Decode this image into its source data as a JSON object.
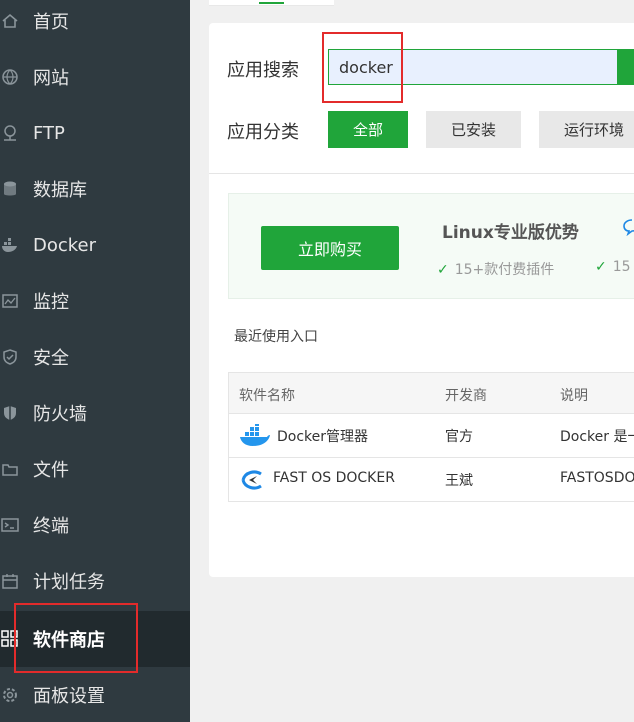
{
  "sidebar": {
    "items": [
      {
        "label": "首页",
        "icon": "home-icon"
      },
      {
        "label": "网站",
        "icon": "globe-icon"
      },
      {
        "label": "FTP",
        "icon": "ftp-icon"
      },
      {
        "label": "数据库",
        "icon": "database-icon"
      },
      {
        "label": "Docker",
        "icon": "docker-icon"
      },
      {
        "label": "监控",
        "icon": "monitor-icon"
      },
      {
        "label": "安全",
        "icon": "shield-icon"
      },
      {
        "label": "防火墙",
        "icon": "firewall-icon"
      },
      {
        "label": "文件",
        "icon": "folder-icon"
      },
      {
        "label": "终端",
        "icon": "terminal-icon"
      },
      {
        "label": "计划任务",
        "icon": "calendar-icon"
      },
      {
        "label": "软件商店",
        "icon": "grid-icon",
        "active": true
      },
      {
        "label": "面板设置",
        "icon": "gear-icon"
      }
    ]
  },
  "search": {
    "label": "应用搜索",
    "value": "docker"
  },
  "category": {
    "label": "应用分类",
    "all": "全部",
    "installed": "已安装",
    "runtime": "运行环境"
  },
  "promo": {
    "buy_label": "立即购买",
    "title": "Linux专业版优势",
    "features": [
      "15+款付费插件",
      "15"
    ]
  },
  "recent_label": "最近使用入口",
  "table": {
    "headers": [
      "软件名称",
      "开发商",
      "说明"
    ],
    "rows": [
      {
        "name": "Docker管理器",
        "dev": "官方",
        "desc": "Docker 是一",
        "icon": "docker-whale-icon"
      },
      {
        "name": "FAST OS DOCKER",
        "dev": "王斌",
        "desc": "FASTOSDO",
        "icon": "fastos-logo-icon"
      }
    ]
  },
  "colors": {
    "sidebar_bg": "#2f3a40",
    "accent": "#20a53a",
    "highlight_box": "#e32b2b"
  }
}
